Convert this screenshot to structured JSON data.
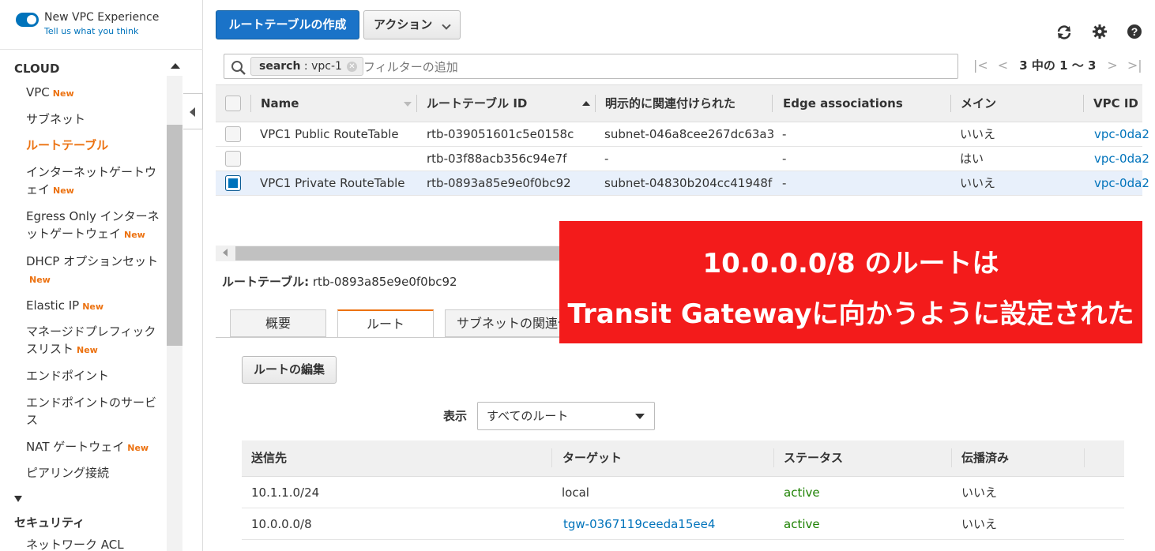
{
  "sidebar": {
    "toggle_title": "New VPC Experience",
    "toggle_link": "Tell us what you think",
    "section_cloud": "CLOUD",
    "section_security": "セキュリティ",
    "new_badge": "New",
    "items": [
      {
        "label": "VPC",
        "new": true
      },
      {
        "label": "サブネット",
        "new": false
      },
      {
        "label": "ルートテーブル",
        "new": false
      },
      {
        "label": "インターネットゲートウェイ",
        "new": true
      },
      {
        "label": "Egress Only インターネットゲートウェイ",
        "new": true
      },
      {
        "label": "DHCP オプションセット",
        "new": true
      },
      {
        "label": "Elastic IP",
        "new": true
      },
      {
        "label": "マネージドプレフィックスリスト",
        "new": true
      },
      {
        "label": "エンドポイント",
        "new": false
      },
      {
        "label": "エンドポイントのサービス",
        "new": false
      },
      {
        "label": "NAT ゲートウェイ",
        "new": true
      },
      {
        "label": "ピアリング接続",
        "new": false
      }
    ],
    "security_items": [
      {
        "label": "ネットワーク ACL"
      }
    ]
  },
  "toolbar": {
    "create_label": "ルートテーブルの作成",
    "actions_label": "アクション"
  },
  "filter": {
    "chip_key": "search",
    "chip_value": " : vpc-1",
    "placeholder": "フィルターの追加",
    "pager_text": "3 中の 1 ～ 3"
  },
  "grid": {
    "columns": [
      "Name",
      "ルートテーブル ID",
      "明示的に関連付けられた",
      "Edge associations",
      "メイン",
      "VPC ID"
    ],
    "rows": [
      {
        "name": "VPC1 Public RouteTable",
        "id": "rtb-039051601c5e0158c",
        "assoc": "subnet-046a8cee267dc63a3",
        "edge": "-",
        "main": "いいえ",
        "vpc": "vpc-0da2",
        "selected": false
      },
      {
        "name": "",
        "id": "rtb-03f88acb356c94e7f",
        "assoc": "-",
        "edge": "-",
        "main": "はい",
        "vpc": "vpc-0da2",
        "selected": false
      },
      {
        "name": "VPC1 Private RouteTable",
        "id": "rtb-0893a85e9e0f0bc92",
        "assoc": "subnet-04830b204cc41948f",
        "edge": "-",
        "main": "いいえ",
        "vpc": "vpc-0da2",
        "selected": true
      }
    ]
  },
  "detail": {
    "label": "ルートテーブル:",
    "value": "rtb-0893a85e9e0f0bc92",
    "tabs": [
      "概要",
      "ルート",
      "サブネットの関連付"
    ],
    "edit_label": "ルートの編集",
    "show_label": "表示",
    "show_value": "すべてのルート",
    "route_columns": [
      "送信先",
      "ターゲット",
      "ステータス",
      "伝播済み"
    ],
    "routes": [
      {
        "dest": "10.1.1.0/24",
        "target": "local",
        "status": "active",
        "propagated": "いいえ",
        "target_link": false
      },
      {
        "dest": "10.0.0.0/8",
        "target": "tgw-0367119ceeda15ee4",
        "status": "active",
        "propagated": "いいえ",
        "target_link": true
      }
    ]
  },
  "banner": {
    "line1": "10.0.0.0/8 のルートは",
    "line2": "Transit Gatewayに向かうように設定された",
    "color": "#f31b1b"
  },
  "colors": {
    "accent": "#ec7211",
    "primary": "#1a73c8",
    "link": "#0073bb",
    "active": "#1d8102"
  }
}
